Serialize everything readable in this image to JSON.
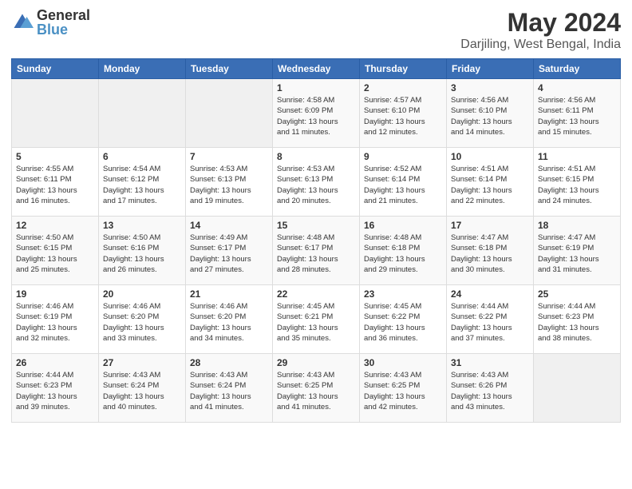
{
  "header": {
    "logo": {
      "line1": "General",
      "line2": "Blue"
    },
    "title": "May 2024",
    "subtitle": "Darjiling, West Bengal, India"
  },
  "weekdays": [
    "Sunday",
    "Monday",
    "Tuesday",
    "Wednesday",
    "Thursday",
    "Friday",
    "Saturday"
  ],
  "weeks": [
    [
      {
        "day": "",
        "info": ""
      },
      {
        "day": "",
        "info": ""
      },
      {
        "day": "",
        "info": ""
      },
      {
        "day": "1",
        "info": "Sunrise: 4:58 AM\nSunset: 6:09 PM\nDaylight: 13 hours\nand 11 minutes."
      },
      {
        "day": "2",
        "info": "Sunrise: 4:57 AM\nSunset: 6:10 PM\nDaylight: 13 hours\nand 12 minutes."
      },
      {
        "day": "3",
        "info": "Sunrise: 4:56 AM\nSunset: 6:10 PM\nDaylight: 13 hours\nand 14 minutes."
      },
      {
        "day": "4",
        "info": "Sunrise: 4:56 AM\nSunset: 6:11 PM\nDaylight: 13 hours\nand 15 minutes."
      }
    ],
    [
      {
        "day": "5",
        "info": "Sunrise: 4:55 AM\nSunset: 6:11 PM\nDaylight: 13 hours\nand 16 minutes."
      },
      {
        "day": "6",
        "info": "Sunrise: 4:54 AM\nSunset: 6:12 PM\nDaylight: 13 hours\nand 17 minutes."
      },
      {
        "day": "7",
        "info": "Sunrise: 4:53 AM\nSunset: 6:13 PM\nDaylight: 13 hours\nand 19 minutes."
      },
      {
        "day": "8",
        "info": "Sunrise: 4:53 AM\nSunset: 6:13 PM\nDaylight: 13 hours\nand 20 minutes."
      },
      {
        "day": "9",
        "info": "Sunrise: 4:52 AM\nSunset: 6:14 PM\nDaylight: 13 hours\nand 21 minutes."
      },
      {
        "day": "10",
        "info": "Sunrise: 4:51 AM\nSunset: 6:14 PM\nDaylight: 13 hours\nand 22 minutes."
      },
      {
        "day": "11",
        "info": "Sunrise: 4:51 AM\nSunset: 6:15 PM\nDaylight: 13 hours\nand 24 minutes."
      }
    ],
    [
      {
        "day": "12",
        "info": "Sunrise: 4:50 AM\nSunset: 6:15 PM\nDaylight: 13 hours\nand 25 minutes."
      },
      {
        "day": "13",
        "info": "Sunrise: 4:50 AM\nSunset: 6:16 PM\nDaylight: 13 hours\nand 26 minutes."
      },
      {
        "day": "14",
        "info": "Sunrise: 4:49 AM\nSunset: 6:17 PM\nDaylight: 13 hours\nand 27 minutes."
      },
      {
        "day": "15",
        "info": "Sunrise: 4:48 AM\nSunset: 6:17 PM\nDaylight: 13 hours\nand 28 minutes."
      },
      {
        "day": "16",
        "info": "Sunrise: 4:48 AM\nSunset: 6:18 PM\nDaylight: 13 hours\nand 29 minutes."
      },
      {
        "day": "17",
        "info": "Sunrise: 4:47 AM\nSunset: 6:18 PM\nDaylight: 13 hours\nand 30 minutes."
      },
      {
        "day": "18",
        "info": "Sunrise: 4:47 AM\nSunset: 6:19 PM\nDaylight: 13 hours\nand 31 minutes."
      }
    ],
    [
      {
        "day": "19",
        "info": "Sunrise: 4:46 AM\nSunset: 6:19 PM\nDaylight: 13 hours\nand 32 minutes."
      },
      {
        "day": "20",
        "info": "Sunrise: 4:46 AM\nSunset: 6:20 PM\nDaylight: 13 hours\nand 33 minutes."
      },
      {
        "day": "21",
        "info": "Sunrise: 4:46 AM\nSunset: 6:20 PM\nDaylight: 13 hours\nand 34 minutes."
      },
      {
        "day": "22",
        "info": "Sunrise: 4:45 AM\nSunset: 6:21 PM\nDaylight: 13 hours\nand 35 minutes."
      },
      {
        "day": "23",
        "info": "Sunrise: 4:45 AM\nSunset: 6:22 PM\nDaylight: 13 hours\nand 36 minutes."
      },
      {
        "day": "24",
        "info": "Sunrise: 4:44 AM\nSunset: 6:22 PM\nDaylight: 13 hours\nand 37 minutes."
      },
      {
        "day": "25",
        "info": "Sunrise: 4:44 AM\nSunset: 6:23 PM\nDaylight: 13 hours\nand 38 minutes."
      }
    ],
    [
      {
        "day": "26",
        "info": "Sunrise: 4:44 AM\nSunset: 6:23 PM\nDaylight: 13 hours\nand 39 minutes."
      },
      {
        "day": "27",
        "info": "Sunrise: 4:43 AM\nSunset: 6:24 PM\nDaylight: 13 hours\nand 40 minutes."
      },
      {
        "day": "28",
        "info": "Sunrise: 4:43 AM\nSunset: 6:24 PM\nDaylight: 13 hours\nand 41 minutes."
      },
      {
        "day": "29",
        "info": "Sunrise: 4:43 AM\nSunset: 6:25 PM\nDaylight: 13 hours\nand 41 minutes."
      },
      {
        "day": "30",
        "info": "Sunrise: 4:43 AM\nSunset: 6:25 PM\nDaylight: 13 hours\nand 42 minutes."
      },
      {
        "day": "31",
        "info": "Sunrise: 4:43 AM\nSunset: 6:26 PM\nDaylight: 13 hours\nand 43 minutes."
      },
      {
        "day": "",
        "info": ""
      }
    ]
  ]
}
